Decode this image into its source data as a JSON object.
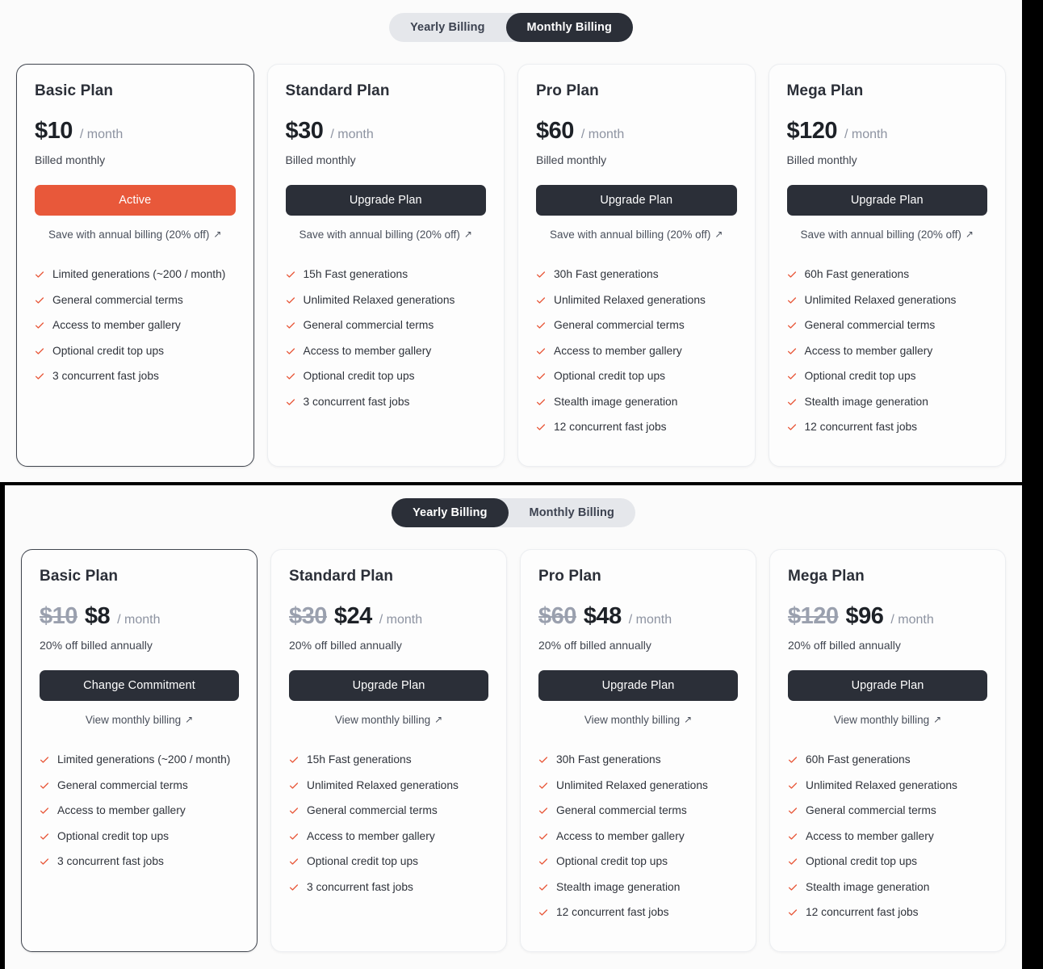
{
  "sections": [
    {
      "id": "monthly",
      "toggle": {
        "options": [
          {
            "label": "Yearly Billing",
            "active": false
          },
          {
            "label": "Monthly Billing",
            "active": true
          }
        ]
      },
      "cards": [
        {
          "name": "Basic Plan",
          "old_price": "",
          "price": "$10",
          "period": "/ month",
          "billed_note": "Billed monthly",
          "cta_label": "Active",
          "cta_style": "active",
          "current": true,
          "sub_link": "Save with annual billing (20% off)",
          "sub_link_arrow": "↗",
          "features": [
            "Limited generations (~200 / month)",
            "General commercial terms",
            "Access to member gallery",
            "Optional credit top ups",
            "3 concurrent fast jobs"
          ]
        },
        {
          "name": "Standard Plan",
          "old_price": "",
          "price": "$30",
          "period": "/ month",
          "billed_note": "Billed monthly",
          "cta_label": "Upgrade Plan",
          "cta_style": "dark",
          "current": false,
          "sub_link": "Save with annual billing (20% off)",
          "sub_link_arrow": "↗",
          "features": [
            "15h Fast generations",
            "Unlimited Relaxed generations",
            "General commercial terms",
            "Access to member gallery",
            "Optional credit top ups",
            "3 concurrent fast jobs"
          ]
        },
        {
          "name": "Pro Plan",
          "old_price": "",
          "price": "$60",
          "period": "/ month",
          "billed_note": "Billed monthly",
          "cta_label": "Upgrade Plan",
          "cta_style": "dark",
          "current": false,
          "sub_link": "Save with annual billing (20% off)",
          "sub_link_arrow": "↗",
          "features": [
            "30h Fast generations",
            "Unlimited Relaxed generations",
            "General commercial terms",
            "Access to member gallery",
            "Optional credit top ups",
            "Stealth image generation",
            "12 concurrent fast jobs"
          ]
        },
        {
          "name": "Mega Plan",
          "old_price": "",
          "price": "$120",
          "period": "/ month",
          "billed_note": "Billed monthly",
          "cta_label": "Upgrade Plan",
          "cta_style": "dark",
          "current": false,
          "sub_link": "Save with annual billing (20% off)",
          "sub_link_arrow": "↗",
          "features": [
            "60h Fast generations",
            "Unlimited Relaxed generations",
            "General commercial terms",
            "Access to member gallery",
            "Optional credit top ups",
            "Stealth image generation",
            "12 concurrent fast jobs"
          ]
        }
      ]
    },
    {
      "id": "yearly",
      "toggle": {
        "options": [
          {
            "label": "Yearly Billing",
            "active": true
          },
          {
            "label": "Monthly Billing",
            "active": false
          }
        ]
      },
      "cards": [
        {
          "name": "Basic Plan",
          "old_price": "$10",
          "price": "$8",
          "period": "/ month",
          "billed_note": "20% off billed annually",
          "cta_label": "Change Commitment",
          "cta_style": "dark",
          "current": true,
          "sub_link": "View monthly billing",
          "sub_link_arrow": "↗",
          "features": [
            "Limited generations (~200 / month)",
            "General commercial terms",
            "Access to member gallery",
            "Optional credit top ups",
            "3 concurrent fast jobs"
          ]
        },
        {
          "name": "Standard Plan",
          "old_price": "$30",
          "price": "$24",
          "period": "/ month",
          "billed_note": "20% off billed annually",
          "cta_label": "Upgrade Plan",
          "cta_style": "dark",
          "current": false,
          "sub_link": "View monthly billing",
          "sub_link_arrow": "↗",
          "features": [
            "15h Fast generations",
            "Unlimited Relaxed generations",
            "General commercial terms",
            "Access to member gallery",
            "Optional credit top ups",
            "3 concurrent fast jobs"
          ]
        },
        {
          "name": "Pro Plan",
          "old_price": "$60",
          "price": "$48",
          "period": "/ month",
          "billed_note": "20% off billed annually",
          "cta_label": "Upgrade Plan",
          "cta_style": "dark",
          "current": false,
          "sub_link": "View monthly billing",
          "sub_link_arrow": "↗",
          "features": [
            "30h Fast generations",
            "Unlimited Relaxed generations",
            "General commercial terms",
            "Access to member gallery",
            "Optional credit top ups",
            "Stealth image generation",
            "12 concurrent fast jobs"
          ]
        },
        {
          "name": "Mega Plan",
          "old_price": "$120",
          "price": "$96",
          "period": "/ month",
          "billed_note": "20% off billed annually",
          "cta_label": "Upgrade Plan",
          "cta_style": "dark",
          "current": false,
          "sub_link": "View monthly billing",
          "sub_link_arrow": "↗",
          "features": [
            "60h Fast generations",
            "Unlimited Relaxed generations",
            "General commercial terms",
            "Access to member gallery",
            "Optional credit top ups",
            "Stealth image generation",
            "12 concurrent fast jobs"
          ]
        }
      ]
    }
  ],
  "colors": {
    "active_cta": "#e8583a",
    "dark_cta": "#2b2f38",
    "check": "#e8583a",
    "toggle_track": "#e5e7eb",
    "toggle_active": "#2b2f38",
    "page_bg": "#fbfbfb"
  }
}
